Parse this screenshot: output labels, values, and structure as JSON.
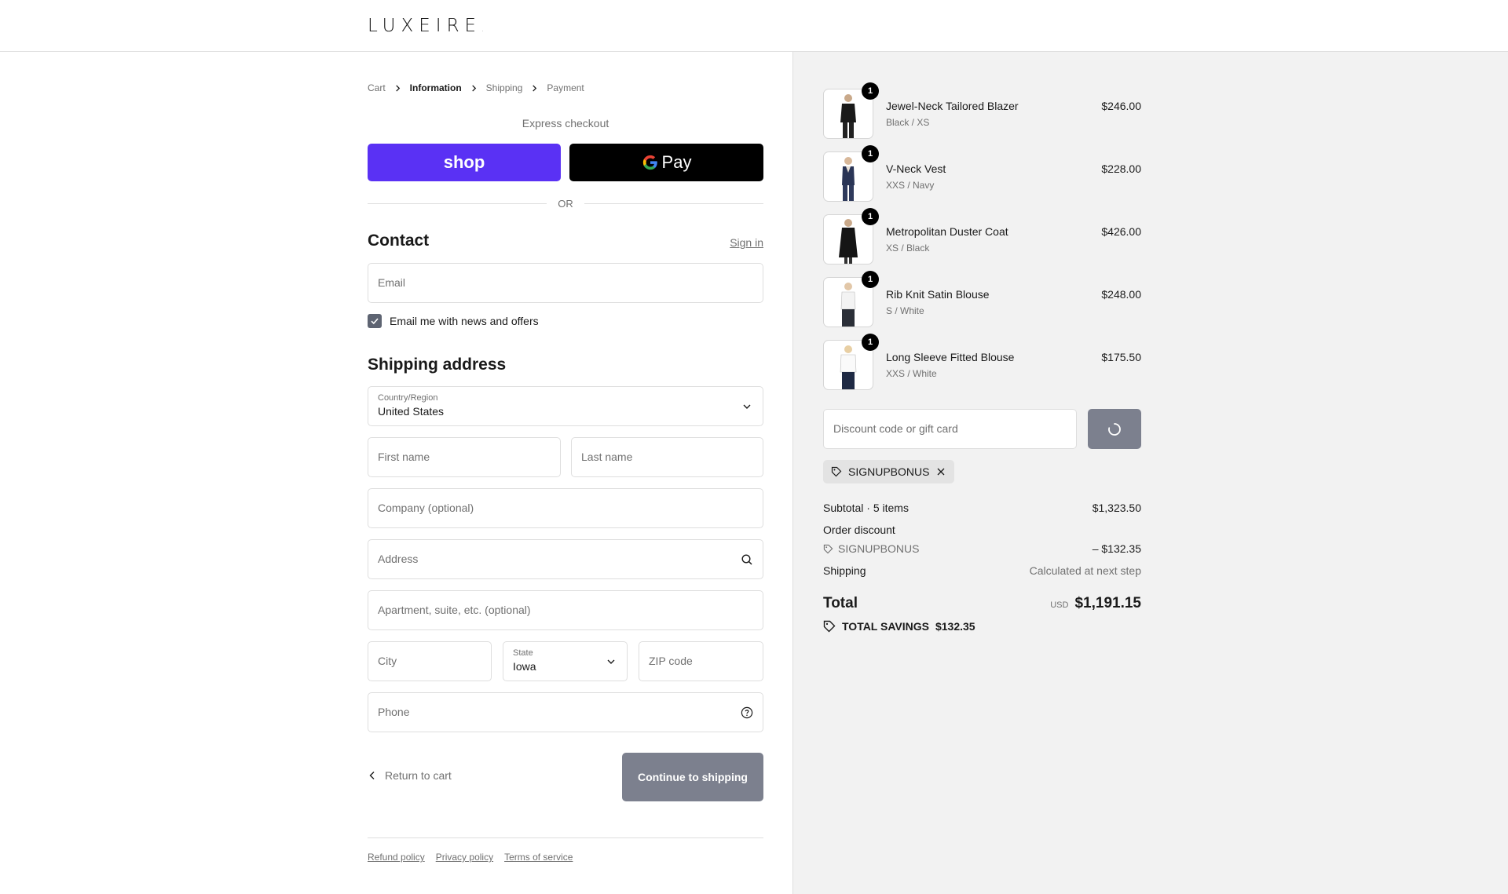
{
  "header": {
    "logo": "LUXEIRE",
    "logo_mark": "."
  },
  "breadcrumb": [
    {
      "label": "Cart",
      "active": false
    },
    {
      "label": "Information",
      "active": true
    },
    {
      "label": "Shipping",
      "active": false
    },
    {
      "label": "Payment",
      "active": false
    }
  ],
  "express": {
    "title": "Express checkout",
    "shop_label": "shop",
    "gpay_label": "Pay",
    "or_label": "OR"
  },
  "contact": {
    "title": "Contact",
    "signin_label": "Sign in",
    "email_placeholder": "Email",
    "newsletter_label": "Email me with news and offers",
    "newsletter_checked": true
  },
  "shipping": {
    "title": "Shipping address",
    "country_label": "Country/Region",
    "country_value": "United States",
    "first_name_placeholder": "First name",
    "last_name_placeholder": "Last name",
    "company_placeholder": "Company (optional)",
    "address_placeholder": "Address",
    "apartment_placeholder": "Apartment, suite, etc. (optional)",
    "city_placeholder": "City",
    "state_label": "State",
    "state_value": "Iowa",
    "zip_placeholder": "ZIP code",
    "phone_placeholder": "Phone"
  },
  "actions": {
    "return_label": "Return to cart",
    "continue_label": "Continue to shipping"
  },
  "footer": {
    "links": [
      "Refund policy",
      "Privacy policy",
      "Terms of service"
    ]
  },
  "cart": {
    "items": [
      {
        "name": "Jewel-Neck Tailored Blazer",
        "variant": "Black / XS",
        "price": "$246.00",
        "qty": "1",
        "icon": "product-thumbnail"
      },
      {
        "name": "V-Neck Vest",
        "variant": "XXS / Navy",
        "price": "$228.00",
        "qty": "1",
        "icon": "product-thumbnail"
      },
      {
        "name": "Metropolitan Duster Coat",
        "variant": "XS / Black",
        "price": "$426.00",
        "qty": "1",
        "icon": "product-thumbnail"
      },
      {
        "name": "Rib Knit Satin Blouse",
        "variant": "S / White",
        "price": "$248.00",
        "qty": "1",
        "icon": "product-thumbnail"
      },
      {
        "name": "Long Sleeve Fitted Blouse",
        "variant": "XXS / White",
        "price": "$175.50",
        "qty": "1",
        "icon": "product-thumbnail"
      }
    ],
    "discount_placeholder": "Discount code or gift card",
    "applied_code": "SIGNUPBONUS"
  },
  "summary": {
    "subtotal_label": "Subtotal · 5 items",
    "subtotal_value": "$1,323.50",
    "order_discount_label": "Order discount",
    "discount_code": "SIGNUPBONUS",
    "discount_value": "– $132.35",
    "shipping_label": "Shipping",
    "shipping_value": "Calculated at next step",
    "total_label": "Total",
    "currency": "USD",
    "total_value": "$1,191.15",
    "savings_label": "TOTAL SAVINGS",
    "savings_value": "$132.35"
  },
  "colors": {
    "shop_pay": "#5a31f4",
    "gpay": "#000000",
    "button_disabled": "#7c808e",
    "panel_bg": "#f2f2f2"
  }
}
